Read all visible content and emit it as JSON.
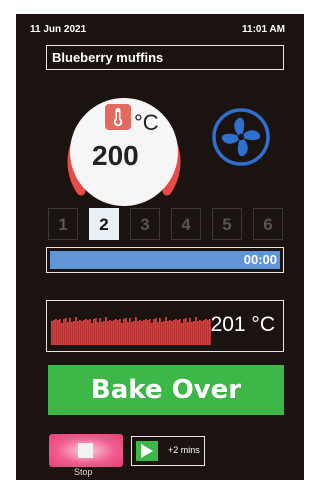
{
  "header": {
    "date": "11 Jun 2021",
    "time": "11:01 AM"
  },
  "recipe": {
    "name": "Blueberry muffins"
  },
  "temperature": {
    "setpoint": "200",
    "unit": "°C",
    "actual": "201 °C"
  },
  "shelves": {
    "items": [
      {
        "label": "1",
        "active": false
      },
      {
        "label": "2",
        "active": true
      },
      {
        "label": "3",
        "active": false
      },
      {
        "label": "4",
        "active": false
      },
      {
        "label": "5",
        "active": false
      },
      {
        "label": "6",
        "active": false
      }
    ]
  },
  "progress": {
    "timer": "00:00",
    "fraction": 1.0
  },
  "status": {
    "label": "Bake Over"
  },
  "controls": {
    "stop_label": "Stop",
    "extend_label": "+2 mins"
  },
  "icons": {
    "thermometer": "thermometer-icon",
    "fan": "fan-icon",
    "stop": "stop-icon",
    "play": "play-icon"
  },
  "colors": {
    "dial_ring": "#e84b45",
    "progress": "#5f94d6",
    "graph": "#e03a3a",
    "bake_over": "#3db848",
    "stop": "#f05d90",
    "fan": "#2f6fd0"
  }
}
